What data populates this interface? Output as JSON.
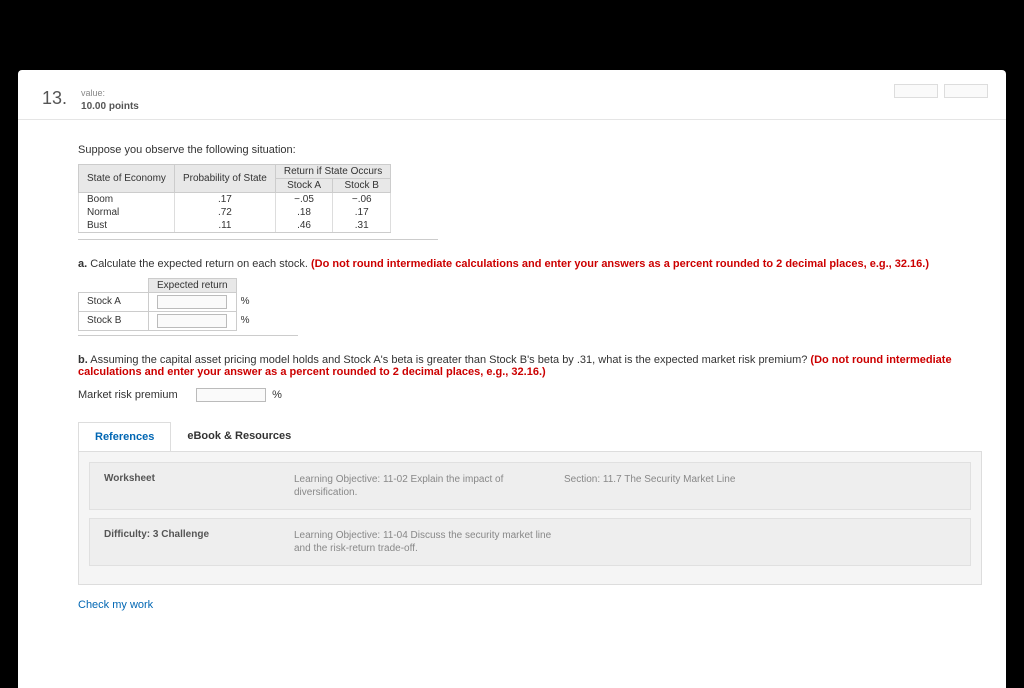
{
  "question_number": "13.",
  "value_label": "value:",
  "points": "10.00 points",
  "intro": "Suppose you observe the following situation:",
  "table1": {
    "h_state": "State of Economy",
    "h_prob": "Probability of State",
    "h_return_span": "Return if State Occurs",
    "h_stockA": "Stock A",
    "h_stockB": "Stock B",
    "rows": [
      {
        "state": "Boom",
        "prob": ".17",
        "a": "−.05",
        "b": "−.06"
      },
      {
        "state": "Normal",
        "prob": ".72",
        "a": ".18",
        "b": ".17"
      },
      {
        "state": "Bust",
        "prob": ".11",
        "a": ".46",
        "b": ".31"
      }
    ]
  },
  "partA": {
    "label": "a.",
    "text": " Calculate the expected return on each stock. ",
    "hint": "(Do not round intermediate calculations and enter your answers as a percent rounded to 2 decimal places, e.g., 32.16.)",
    "col_header": "Expected return",
    "rowA": "Stock A",
    "rowB": "Stock B",
    "pct": "%"
  },
  "partB": {
    "label": "b.",
    "text": " Assuming the capital asset pricing model holds and Stock A's beta is greater than Stock B's beta by .31, what is the expected market risk premium? ",
    "hint": "(Do not round intermediate calculations and enter your answer as a percent rounded to 2 decimal places, e.g., 32.16.)",
    "mrp_label": "Market risk premium",
    "pct": "%"
  },
  "tabs": {
    "references": "References",
    "ebook": "eBook & Resources"
  },
  "refs": {
    "r1c1": "Worksheet",
    "r1c2": "Learning Objective: 11-02 Explain the impact of diversification.",
    "r1c3": "Section: 11.7 The Security Market Line",
    "r2c1": "Difficulty: 3 Challenge",
    "r2c2": "Learning Objective: 11-04 Discuss the security market line and the risk-return trade-off.",
    "r2c3": ""
  },
  "check_link": "Check my work"
}
